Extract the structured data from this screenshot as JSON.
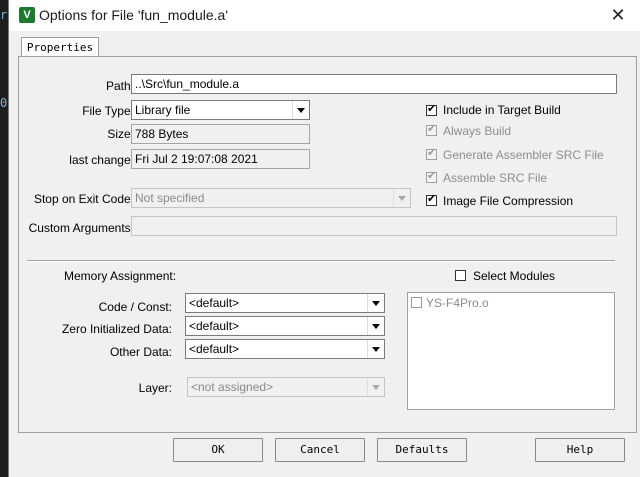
{
  "window": {
    "title": "Options for File 'fun_module.a'",
    "close_glyph": "✕",
    "icon": "keil-v-icon"
  },
  "tabs": [
    {
      "label": "Properties",
      "active": true
    }
  ],
  "path": {
    "label": "Path:",
    "value": "..\\Src\\fun_module.a"
  },
  "file_type": {
    "label": "File Type:",
    "value": "Library file"
  },
  "size": {
    "label": "Size:",
    "value": "788 Bytes"
  },
  "last_change": {
    "label": "last change:",
    "value": "Fri Jul  2 19:07:08 2021"
  },
  "stop_on_exit": {
    "label": "Stop on Exit Code:",
    "value": "Not specified"
  },
  "custom_args": {
    "label": "Custom Arguments:",
    "value": ""
  },
  "options": [
    {
      "label": "Include in Target Build",
      "checked": true,
      "enabled": true
    },
    {
      "label": "Always Build",
      "checked": true,
      "enabled": false
    },
    {
      "label": "Generate Assembler SRC File",
      "checked": true,
      "enabled": false
    },
    {
      "label": "Assemble SRC File",
      "checked": true,
      "enabled": false
    },
    {
      "label": "Image File Compression",
      "checked": true,
      "enabled": true
    }
  ],
  "memory": {
    "heading": "Memory Assignment:",
    "code_const": {
      "label": "Code / Const:",
      "value": "<default>"
    },
    "zero_init": {
      "label": "Zero Initialized Data:",
      "value": "<default>"
    },
    "other_data": {
      "label": "Other Data:",
      "value": "<default>"
    },
    "layer": {
      "label": "Layer:",
      "value": "<not assigned>"
    }
  },
  "modules": {
    "label": "Select Modules",
    "checked": false,
    "items": [
      {
        "label": "YS-F4Pro.o",
        "checked": false
      }
    ]
  },
  "buttons": {
    "ok": "OK",
    "cancel": "Cancel",
    "defaults": "Defaults",
    "help": "Help"
  },
  "colors": {
    "dialog_bg": "#f0f0f0",
    "border": "#a0a0a0",
    "disabled_text": "#8a8a8a"
  }
}
